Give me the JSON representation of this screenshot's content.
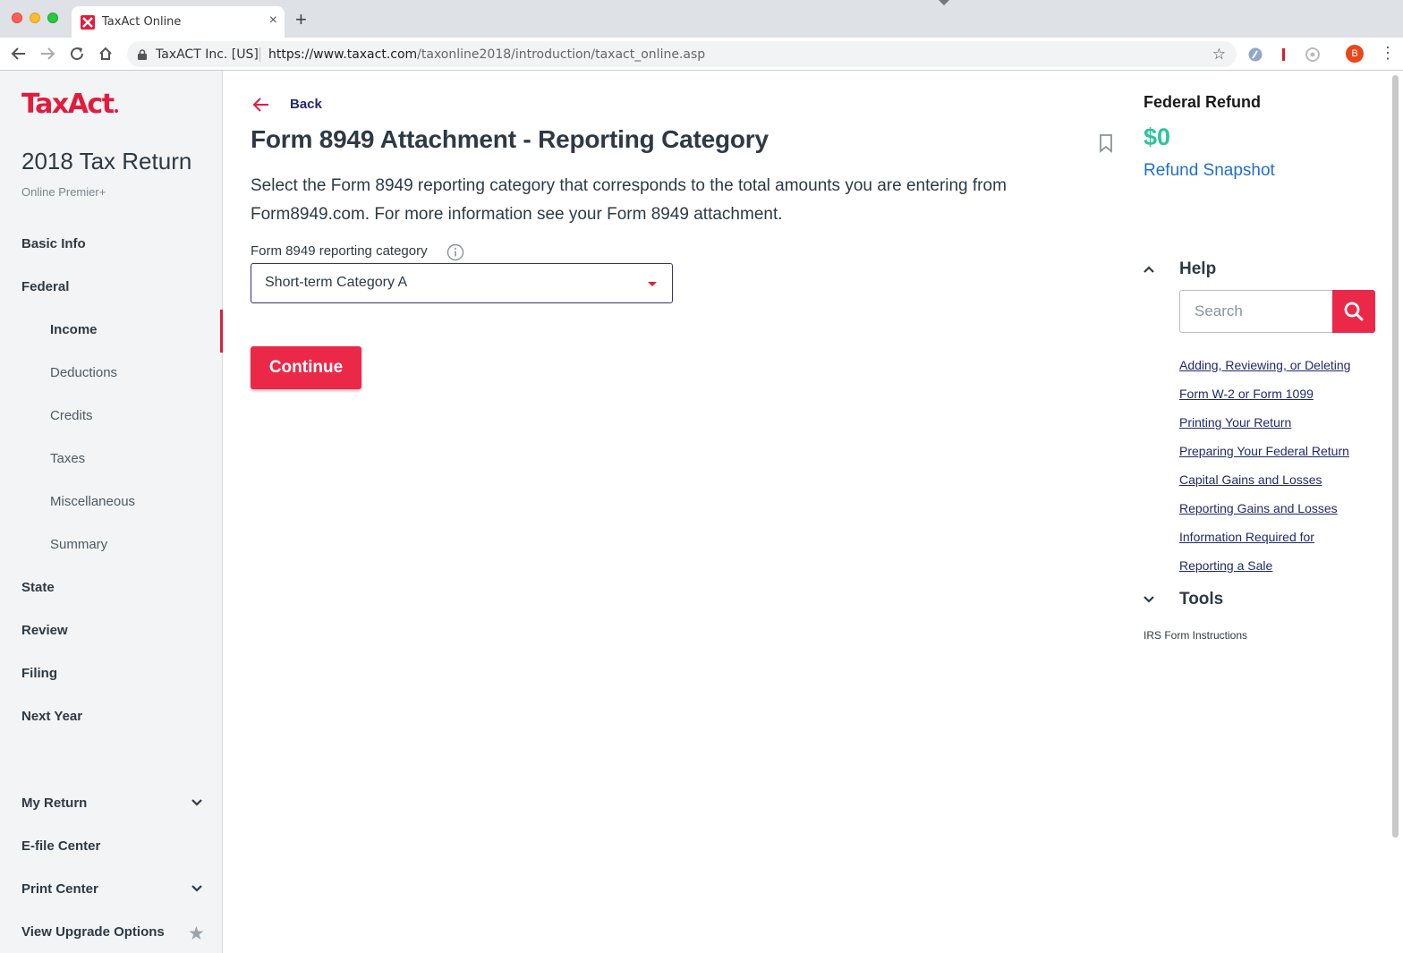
{
  "browser": {
    "tab_title": "TaxAct Online",
    "new_tab": "+",
    "site_identity": "TaxACT Inc. [US]",
    "url_host": "https://www.taxact.com",
    "url_path": "/taxonline2018/introduction/taxact_online.asp",
    "profile_initial": "B"
  },
  "sidebar": {
    "logo": "TaxAct",
    "return_title": "2018 Tax Return",
    "edition": "Online Premier+",
    "nav": {
      "basic_info": "Basic Info",
      "federal": "Federal",
      "income": "Income",
      "deductions": "Deductions",
      "credits": "Credits",
      "taxes": "Taxes",
      "miscellaneous": "Miscellaneous",
      "summary": "Summary",
      "state": "State",
      "review": "Review",
      "filing": "Filing",
      "next_year": "Next Year"
    },
    "footer": {
      "my_return": "My Return",
      "efile_center": "E-file Center",
      "print_center": "Print Center",
      "upgrade": "View Upgrade Options"
    }
  },
  "main": {
    "back_label": "Back",
    "title": "Form 8949 Attachment - Reporting Category",
    "description": "Select the Form 8949 reporting category that corresponds to the total amounts you are entering from Form8949.com. For more information see your Form 8949 attachment.",
    "field_label": "Form 8949 reporting category",
    "selected_value": "Short-term Category A",
    "continue_label": "Continue"
  },
  "right_panel": {
    "refund_label": "Federal Refund",
    "refund_amount": "$0",
    "refund_snapshot": "Refund Snapshot",
    "help_title": "Help",
    "search_placeholder": "Search",
    "help_links": [
      "Adding, Reviewing, or Deleting",
      "Form W-2 or Form 1099",
      "Printing Your Return",
      "Preparing Your Federal Return",
      "Capital Gains and Losses",
      "Reporting Gains and Losses",
      "Information Required for",
      "Reporting a Sale"
    ],
    "tools_title": "Tools",
    "tools_link": "IRS Form Instructions"
  },
  "colors": {
    "brand_red": "#e31b3c",
    "button_red": "#ec2848",
    "refund_green": "#2ec4a0",
    "link_blue": "#1f6fd6",
    "navy": "#1f2a6b"
  }
}
